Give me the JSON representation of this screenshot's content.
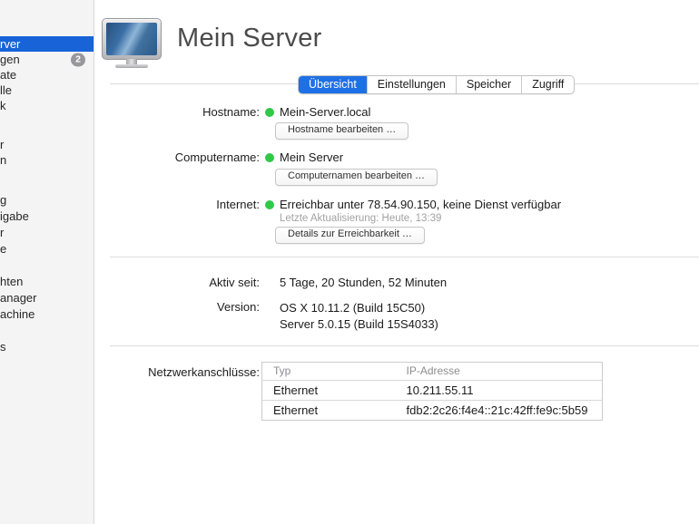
{
  "colors": {
    "sidebar_selected_blue": "#1863d8",
    "tab_selected_blue": "#1e70e6",
    "status_green": "#31c848",
    "badge_gray": "#97979c"
  },
  "sidebar": {
    "sections": [
      {
        "items": [
          {
            "name": "mein-server",
            "label": "rver",
            "selected": true
          },
          {
            "name": "warnungen",
            "label": "gen",
            "badge": "2"
          },
          {
            "name": "zertifikate",
            "label": "ate"
          },
          {
            "name": "protokolle",
            "label": "lle"
          },
          {
            "name": "statistik",
            "label": "k"
          }
        ]
      },
      {
        "items": [
          {
            "name": "benutzer",
            "label": "r"
          },
          {
            "name": "gruppen",
            "label": "n"
          }
        ]
      },
      {
        "items": [
          {
            "name": "caching",
            "label": "g"
          },
          {
            "name": "dateifreigabe",
            "label": "igabe"
          },
          {
            "name": "kalender",
            "label": "r"
          },
          {
            "name": "kontakte",
            "label": "e"
          },
          {
            "name": "mail",
            "label": ""
          },
          {
            "name": "nachrichten",
            "label": "hten"
          },
          {
            "name": "profilmanager",
            "label": "anager"
          },
          {
            "name": "time-machine",
            "label": "achine"
          },
          {
            "name": "vpn",
            "label": ""
          },
          {
            "name": "websites",
            "label": "s"
          }
        ]
      }
    ]
  },
  "header": {
    "title": "Mein Server",
    "icon": "display-icon"
  },
  "tabs": {
    "items": [
      {
        "name": "uebersicht",
        "label": "Übersicht",
        "selected": true
      },
      {
        "name": "einstellungen",
        "label": "Einstellungen",
        "selected": false
      },
      {
        "name": "speicher",
        "label": "Speicher",
        "selected": false
      },
      {
        "name": "zugriff",
        "label": "Zugriff",
        "selected": false
      }
    ]
  },
  "overview": {
    "hostname": {
      "label": "Hostname:",
      "value": "Mein-Server.local",
      "button": "Hostname bearbeiten …"
    },
    "computername": {
      "label": "Computername:",
      "value": "Mein Server",
      "button": "Computernamen bearbeiten …"
    },
    "internet": {
      "label": "Internet:",
      "value": "Erreichbar unter 78.54.90.150, keine Dienst verfügbar",
      "updated": "Letzte Aktualisierung: Heute, 13:39",
      "button": "Details zur Erreichbarkeit …"
    },
    "uptime": {
      "label": "Aktiv seit:",
      "value": "5 Tage, 20 Stunden, 52 Minuten"
    },
    "version": {
      "label": "Version:",
      "lines": [
        "OS X 10.11.2 (Build 15C50)",
        "Server 5.0.15 (Build 15S4033)"
      ]
    },
    "network": {
      "label": "Netzwerkanschlüsse:",
      "columns": [
        "Typ",
        "IP-Adresse"
      ],
      "rows": [
        [
          "Ethernet",
          "10.211.55.11"
        ],
        [
          "Ethernet",
          "fdb2:2c26:f4e4::21c:42ff:fe9c:5b59"
        ]
      ]
    }
  }
}
